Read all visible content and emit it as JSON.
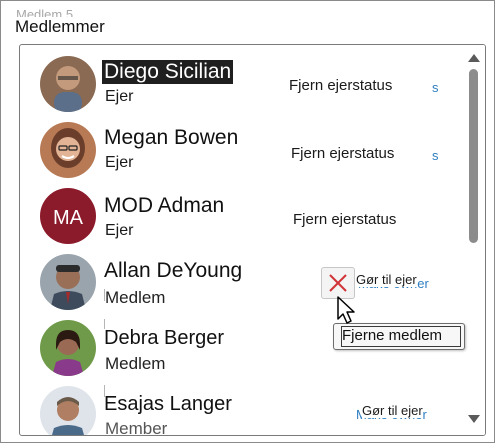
{
  "header": {
    "title": "Medlemmer",
    "ghost_text": "Medlem 5"
  },
  "members": [
    {
      "name": "Diego Sicilian",
      "role": "Ejer",
      "action": "Fjern ejerstatus",
      "avatar_icon": "person-photo-icon",
      "avatar_colors": [
        "#7a5a44",
        "#c49a7c"
      ],
      "selected": true
    },
    {
      "name": "Megan Bowen",
      "role": "Ejer",
      "action": "Fjern ejerstatus",
      "avatar_icon": "person-photo-icon",
      "avatar_colors": [
        "#6b3e2c",
        "#e2b394"
      ]
    },
    {
      "name": "MOD Adman",
      "role": "Ejer",
      "action": "Fjern ejerstatus",
      "avatar_icon": "initials-avatar",
      "avatar_initials": "MA",
      "avatar_colors": [
        "#8b1a2b",
        "#ffffff"
      ]
    },
    {
      "name": "Allan DeYoung",
      "role": "Medlem",
      "action": "Gør til ejer",
      "ghost_action": "Make owner",
      "avatar_icon": "person-photo-icon",
      "avatar_colors": [
        "#3d4b5c",
        "#9a6f58"
      ]
    },
    {
      "name": "Debra Berger",
      "role": "Medlem",
      "avatar_icon": "person-photo-icon",
      "avatar_colors": [
        "#4d7d3a",
        "#9b6a55"
      ]
    },
    {
      "name": "Esajas Langer",
      "role": "Member",
      "action": "Gør til ejer",
      "ghost_action": "Make owner",
      "avatar_icon": "person-photo-icon",
      "avatar_colors": [
        "#cfd6de",
        "#b07e62"
      ]
    }
  ],
  "ghost_link_s": "s",
  "remove_button": {
    "icon": "close-icon",
    "color": "#d13438"
  },
  "tooltip": {
    "text": "Fjerne medlem"
  },
  "colors": {
    "link": "#2f7fc1",
    "selection": "#1f1f1f"
  }
}
